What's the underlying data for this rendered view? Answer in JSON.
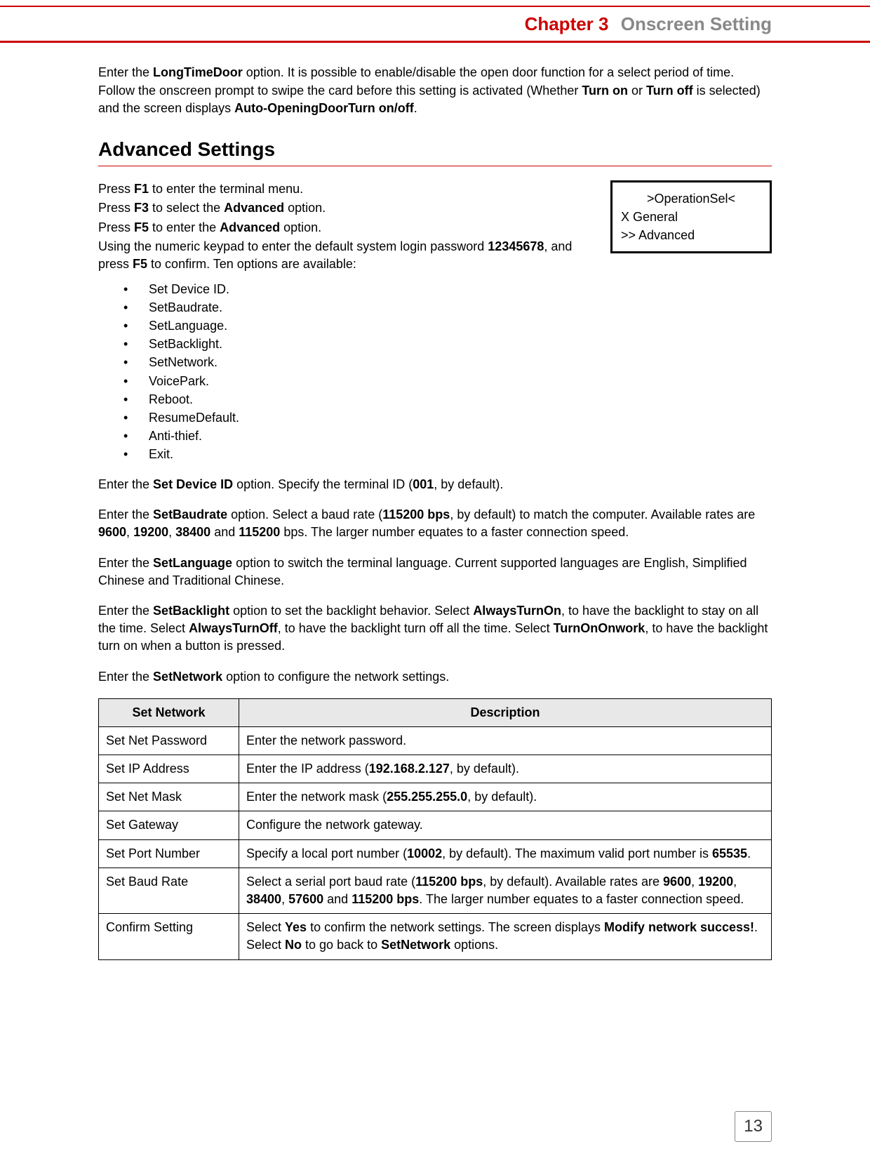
{
  "header": {
    "chapter_number": "Chapter 3",
    "chapter_title": "Onscreen Setting"
  },
  "intro": {
    "text_before_ltd": "Enter the ",
    "ltd": "LongTimeDoor",
    "text_after_ltd": " option. It is possible to enable/disable the open door function for a select period of time. Follow the onscreen prompt to swipe the card before this setting is activated (Whether ",
    "turnon": "Turn on",
    "or": " or ",
    "turnoff": "Turn off",
    "text_after_turnoff": " is selected) and the screen displays ",
    "autodoor": "Auto-OpeningDoorTurn on/off",
    "period": "."
  },
  "section_heading": "Advanced Settings",
  "onscreen": {
    "l1": ">OperationSel<",
    "l2": "X General",
    "l3": ">> Advanced"
  },
  "steps": {
    "p1a": "Press ",
    "p1b": "F1",
    "p1c": " to enter the terminal menu.",
    "p2a": "Press ",
    "p2b": "F3",
    "p2c": " to select the ",
    "p2d": "Advanced",
    "p2e": " option.",
    "p3a": "Press ",
    "p3b": "F5",
    "p3c": " to enter the ",
    "p3d": "Advanced",
    "p3e": " option.",
    "p4a": "Using the numeric keypad to enter the default system login password ",
    "p4b": "12345678",
    "p4c": ", and press ",
    "p4d": "F5",
    "p4e": " to confirm. Ten options are available:"
  },
  "options": [
    "Set Device ID.",
    "SetBaudrate.",
    "SetLanguage.",
    "SetBacklight.",
    "SetNetwork.",
    "VoicePark.",
    "Reboot.",
    "ResumeDefault.",
    "Anti-thief.",
    "Exit."
  ],
  "paras": {
    "dev": {
      "a": "Enter the ",
      "b": "Set Device ID",
      "c": " option. Specify the terminal ID (",
      "d": "001",
      "e": ", by default)."
    },
    "baud": {
      "a": "Enter the ",
      "b": "SetBaudrate",
      "c": " option. Select a baud rate (",
      "d": "115200 bps",
      "e": ", by default) to match the computer. Available rates are ",
      "f": "9600",
      "g": ", ",
      "h": "19200",
      "i": ", ",
      "j": "38400",
      "k": " and ",
      "l": "115200",
      "m": " bps. The larger number equates to a faster connection speed."
    },
    "lang": {
      "a": "Enter the ",
      "b": "SetLanguage",
      "c": " option to switch the terminal language. Current supported languages are English, Simplified Chinese and Traditional Chinese."
    },
    "back": {
      "a": "Enter the ",
      "b": "SetBacklight",
      "c": " option to set the backlight behavior. Select ",
      "d": "AlwaysTurnOn",
      "e": ", to have the backlight to stay on all the time. Select ",
      "f": "AlwaysTurnOff",
      "g": ", to have the backlight turn off all the time. Select ",
      "h": "TurnOnOnwork",
      "i": ", to have the backlight turn on when a button is pressed."
    },
    "net": {
      "a": "Enter the ",
      "b": "SetNetwork",
      "c": " option to configure the network settings."
    }
  },
  "table": {
    "headers": [
      "Set Network",
      "Description"
    ],
    "rows": [
      {
        "label": "Set Net Password",
        "desc": [
          {
            "t": "Enter the network password."
          }
        ]
      },
      {
        "label": "Set IP Address",
        "desc": [
          {
            "t": "Enter the IP address ("
          },
          {
            "b": "192.168.2.127"
          },
          {
            "t": ", by default)."
          }
        ]
      },
      {
        "label": "Set Net Mask",
        "desc": [
          {
            "t": "Enter the network mask ("
          },
          {
            "b": "255.255.255.0"
          },
          {
            "t": ", by default)."
          }
        ]
      },
      {
        "label": "Set Gateway",
        "desc": [
          {
            "t": "Configure the network gateway."
          }
        ]
      },
      {
        "label": "Set Port Number",
        "desc": [
          {
            "t": "Specify a local port number ("
          },
          {
            "b": "10002"
          },
          {
            "t": ", by default). The maximum valid port number is "
          },
          {
            "b": "65535"
          },
          {
            "t": "."
          }
        ]
      },
      {
        "label": "Set Baud Rate",
        "desc": [
          {
            "t": "Select a serial port baud rate ("
          },
          {
            "b": "115200 bps"
          },
          {
            "t": ", by default). Available rates are "
          },
          {
            "b": "9600"
          },
          {
            "t": ", "
          },
          {
            "b": "19200"
          },
          {
            "t": ", "
          },
          {
            "b": "38400"
          },
          {
            "t": ", "
          },
          {
            "b": "57600"
          },
          {
            "t": " and "
          },
          {
            "b": "115200 bps"
          },
          {
            "t": ". The larger number equates to a faster connection speed."
          }
        ]
      },
      {
        "label": "Confirm Setting",
        "desc": [
          {
            "t": "Select "
          },
          {
            "b": "Yes"
          },
          {
            "t": " to confirm the network settings. The screen displays "
          },
          {
            "b": "Modify network success!"
          },
          {
            "t": "."
          },
          {
            "br": true
          },
          {
            "t": "Select "
          },
          {
            "b": "No"
          },
          {
            "t": " to go back to "
          },
          {
            "b": "SetNetwork"
          },
          {
            "t": " options."
          }
        ]
      }
    ]
  },
  "page_number": "13"
}
